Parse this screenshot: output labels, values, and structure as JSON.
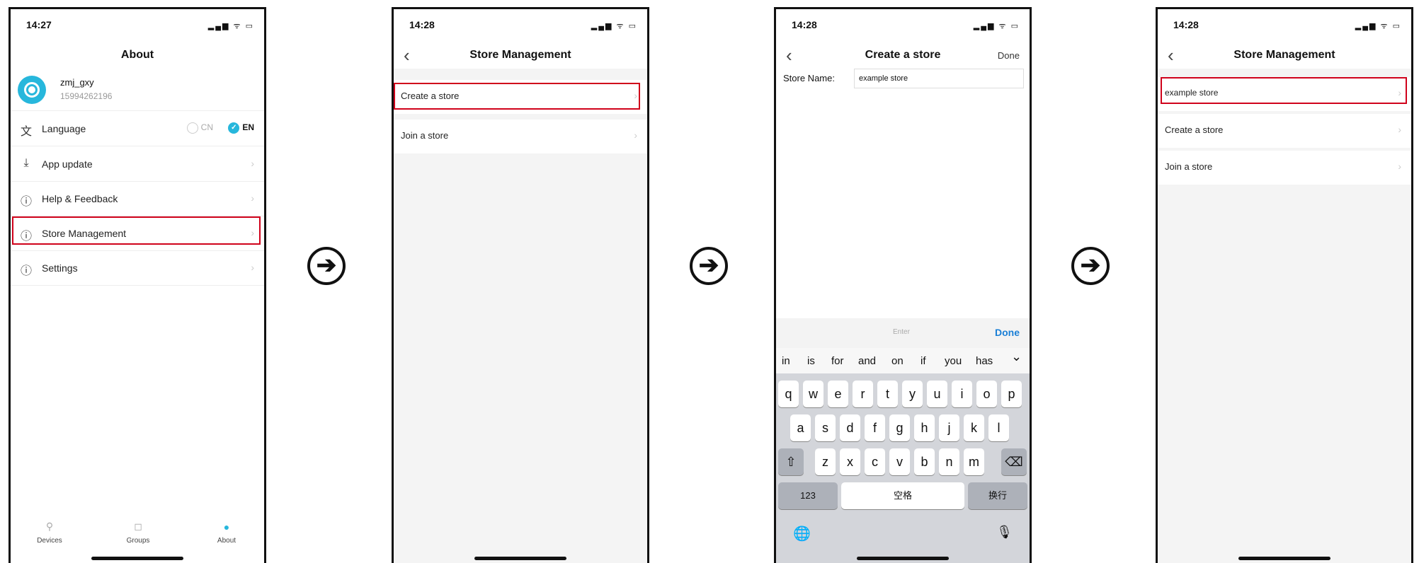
{
  "arrow_glyph": "➔",
  "screen1": {
    "time": "14:27",
    "status_icons": "▂▄▆ ᯤ ▭",
    "title": "About",
    "username": "zmj_gxy",
    "phone": "15994262196",
    "language_label": "Language",
    "lang_cn": "CN",
    "lang_en": "EN",
    "menu": [
      {
        "label": "App update",
        "icon": "download-icon",
        "glyph": "⤓"
      },
      {
        "label": "Help & Feedback",
        "icon": "info-icon",
        "glyph": "ⓘ"
      },
      {
        "label": "Store Management",
        "icon": "info-icon",
        "glyph": "ⓘ"
      },
      {
        "label": "Settings",
        "icon": "info-icon",
        "glyph": "ⓘ"
      }
    ],
    "tabs": [
      {
        "label": "Devices",
        "glyph": "⚲"
      },
      {
        "label": "Groups",
        "glyph": "◻"
      },
      {
        "label": "About",
        "glyph": "●"
      }
    ],
    "chevron": "›"
  },
  "screen2": {
    "time": "14:28",
    "title": "Store Management",
    "items": [
      "Create a store",
      "Join a store"
    ]
  },
  "screen3": {
    "time": "14:28",
    "title": "Create a store",
    "done": "Done",
    "field_label": "Store Name:",
    "field_value": "example store",
    "kb_placeholder": "Enter",
    "kb_done": "Done",
    "suggestions": [
      "in",
      "is",
      "for",
      "and",
      "on",
      "if",
      "you",
      "has"
    ],
    "row1": [
      "q",
      "w",
      "e",
      "r",
      "t",
      "y",
      "u",
      "i",
      "o",
      "p"
    ],
    "row2": [
      "a",
      "s",
      "d",
      "f",
      "g",
      "h",
      "j",
      "k",
      "l"
    ],
    "row3": [
      "z",
      "x",
      "c",
      "v",
      "b",
      "n",
      "m"
    ],
    "key_123": "123",
    "space": "空格",
    "return": "换行",
    "shift": "⇧",
    "delete": "⌫",
    "globe": "🌐",
    "mic": "🎙",
    "collapse": "⌄"
  },
  "screen4": {
    "time": "14:28",
    "title": "Store Management",
    "items": [
      "example store",
      "Create a store",
      "Join a store"
    ]
  },
  "colors": {
    "accent": "#27b7dc",
    "highlight": "#d0021b"
  }
}
